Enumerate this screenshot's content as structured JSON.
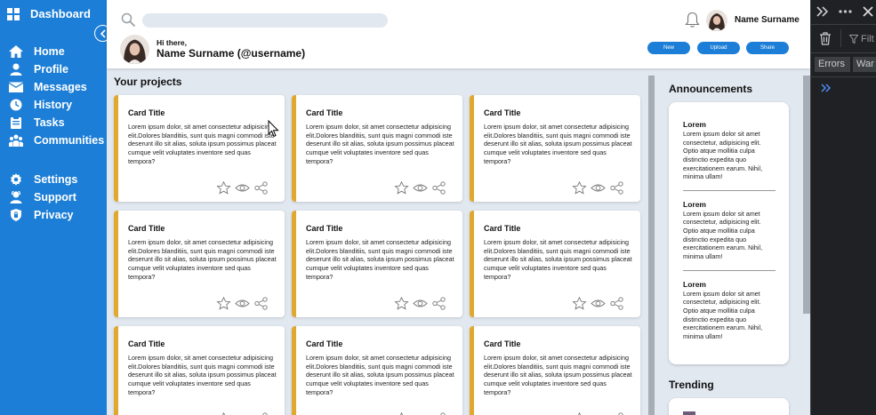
{
  "sidebar": {
    "title": "Dashboard",
    "main_items": [
      {
        "label": "Home",
        "icon": "home-icon"
      },
      {
        "label": "Profile",
        "icon": "profile-icon"
      },
      {
        "label": "Messages",
        "icon": "messages-icon"
      },
      {
        "label": "History",
        "icon": "history-icon"
      },
      {
        "label": "Tasks",
        "icon": "tasks-icon"
      },
      {
        "label": "Communities",
        "icon": "communities-icon"
      }
    ],
    "secondary_items": [
      {
        "label": "Settings",
        "icon": "gear-icon"
      },
      {
        "label": "Support",
        "icon": "support-icon"
      },
      {
        "label": "Privacy",
        "icon": "shield-icon"
      }
    ]
  },
  "header": {
    "user_name": "Name Surname",
    "greeting": "Hi there,",
    "greeting_name": "Name Surname (@username)",
    "buttons": {
      "new": "New",
      "upload": "Upload",
      "share": "Share"
    }
  },
  "projects": {
    "title": "Your projects",
    "cards": [
      {
        "title": "Card Title",
        "body": "Lorem ipsum dolor, sit amet consectetur adipisicing elit.Dolores blanditiis, sunt quis magni commodi iste deserunt illo sit alias, soluta ipsum possimus placeat cumque velit voluptates inventore sed quas tempora?"
      },
      {
        "title": "Card Title",
        "body": "Lorem ipsum dolor, sit amet consectetur adipisicing elit.Dolores blanditiis, sunt quis magni commodi iste deserunt illo sit alias, soluta ipsum possimus placeat cumque velit voluptates inventore sed quas tempora?"
      },
      {
        "title": "Card Title",
        "body": "Lorem ipsum dolor, sit amet consectetur adipisicing elit.Dolores blanditiis, sunt quis magni commodi iste deserunt illo sit alias, soluta ipsum possimus placeat cumque velit voluptates inventore sed quas tempora?"
      },
      {
        "title": "Card Title",
        "body": "Lorem ipsum dolor, sit amet consectetur adipisicing elit.Dolores blanditiis, sunt quis magni commodi iste deserunt illo sit alias, soluta ipsum possimus placeat cumque velit voluptates inventore sed quas tempora?"
      },
      {
        "title": "Card Title",
        "body": "Lorem ipsum dolor, sit amet consectetur adipisicing elit.Dolores blanditiis, sunt quis magni commodi iste deserunt illo sit alias, soluta ipsum possimus placeat cumque velit voluptates inventore sed quas tempora?"
      },
      {
        "title": "Card Title",
        "body": "Lorem ipsum dolor, sit amet consectetur adipisicing elit.Dolores blanditiis, sunt quis magni commodi iste deserunt illo sit alias, soluta ipsum possimus placeat cumque velit voluptates inventore sed quas tempora?"
      },
      {
        "title": "Card Title",
        "body": "Lorem ipsum dolor, sit amet consectetur adipisicing elit.Dolores blanditiis, sunt quis magni commodi iste deserunt illo sit alias, soluta ipsum possimus placeat cumque velit voluptates inventore sed quas tempora?"
      },
      {
        "title": "Card Title",
        "body": "Lorem ipsum dolor, sit amet consectetur adipisicing elit.Dolores blanditiis, sunt quis magni commodi iste deserunt illo sit alias, soluta ipsum possimus placeat cumque velit voluptates inventore sed quas tempora?"
      },
      {
        "title": "Card Title",
        "body": "Lorem ipsum dolor, sit amet consectetur adipisicing elit.Dolores blanditiis, sunt quis magni commodi iste deserunt illo sit alias, soluta ipsum possimus placeat cumque velit voluptates inventore sed quas tempora?"
      }
    ]
  },
  "announcements": {
    "title": "Announcements",
    "items": [
      {
        "title": "Lorem",
        "body": "Lorem ipsum dolor sit amet consectetur, adipisicing elit. Optio atque mollitia culpa distinctio expedita quo exercitationem earum. Nihil, minima ullam!"
      },
      {
        "title": "Lorem",
        "body": "Lorem ipsum dolor sit amet consectetur, adipisicing elit. Optio atque mollitia culpa distinctio expedita quo exercitationem earum. Nihil, minima ullam!"
      },
      {
        "title": "Lorem",
        "body": "Lorem ipsum dolor sit amet consectetur, adipisicing elit. Optio atque mollitia culpa distinctio expedita quo exercitationem earum. Nihil, minima ullam!"
      }
    ]
  },
  "trending": {
    "title": "Trending"
  },
  "devtools": {
    "filter_label": "Filt",
    "tabs": [
      "Errors",
      "War"
    ]
  },
  "colors": {
    "sidebar": "#1c7ed6",
    "accent": "#e0a82e",
    "background": "#e2e8f0"
  }
}
